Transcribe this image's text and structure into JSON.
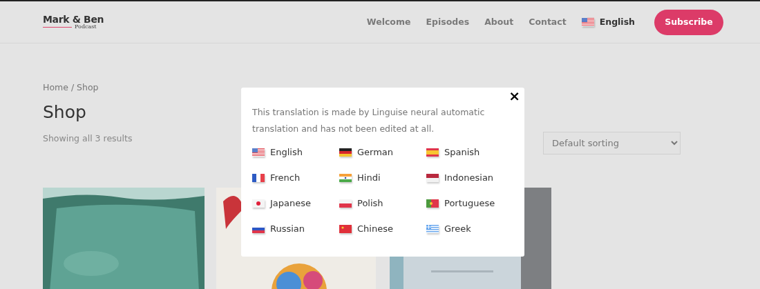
{
  "header": {
    "logo": {
      "title": "Mark & Ben",
      "subtitle": "Podcast"
    },
    "nav": [
      {
        "label": "Welcome"
      },
      {
        "label": "Episodes"
      },
      {
        "label": "About"
      },
      {
        "label": "Contact"
      }
    ],
    "language": {
      "label": "English",
      "kind": "us"
    },
    "subscribe": "Subscribe"
  },
  "breadcrumb": "Home / Shop",
  "title": "Shop",
  "result_count": "Showing all 3 results",
  "sorting": {
    "value": "Default sorting"
  },
  "modal": {
    "close": "×",
    "message": "This translation is made by Linguise neural automatic translation and has not been edited at all.",
    "languages": [
      {
        "label": "English",
        "kind": "us"
      },
      {
        "label": "German",
        "kind": "de"
      },
      {
        "label": "Spanish",
        "kind": "es"
      },
      {
        "label": "French",
        "kind": "fr"
      },
      {
        "label": "Hindi",
        "kind": "in"
      },
      {
        "label": "Indonesian",
        "kind": "id"
      },
      {
        "label": "Japanese",
        "kind": "jp"
      },
      {
        "label": "Polish",
        "kind": "pl"
      },
      {
        "label": "Portuguese",
        "kind": "pt"
      },
      {
        "label": "Russian",
        "kind": "ru"
      },
      {
        "label": "Chinese",
        "kind": "cn"
      },
      {
        "label": "Greek",
        "kind": "gr"
      }
    ]
  }
}
